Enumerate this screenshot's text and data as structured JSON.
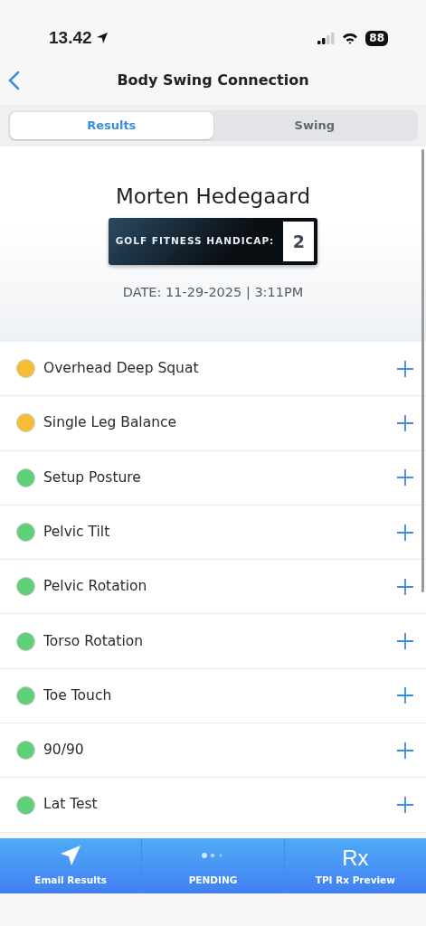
{
  "status_bar": {
    "time": "13.42",
    "battery": "88"
  },
  "nav": {
    "title": "Body Swing Connection"
  },
  "tabs": [
    {
      "label": "Results",
      "selected": true
    },
    {
      "label": "Swing",
      "selected": false
    }
  ],
  "profile": {
    "name": "Morten Hedegaard",
    "handicap_label": "GOLF FITNESS HANDICAP:",
    "handicap_value": "2",
    "date": "DATE: 11-29-2025 | 3:11PM"
  },
  "tests": [
    {
      "name": "Overhead Deep Squat",
      "color": "#f5bd36"
    },
    {
      "name": "Single Leg Balance",
      "color": "#f5bd36"
    },
    {
      "name": "Setup Posture",
      "color": "#5fcf78"
    },
    {
      "name": "Pelvic Tilt",
      "color": "#5fcf78"
    },
    {
      "name": "Pelvic Rotation",
      "color": "#5fcf78"
    },
    {
      "name": "Torso Rotation",
      "color": "#5fcf78"
    },
    {
      "name": "Toe Touch",
      "color": "#5fcf78"
    },
    {
      "name": "90/90",
      "color": "#5fcf78"
    },
    {
      "name": "Lat Test",
      "color": "#5fcf78"
    }
  ],
  "bottom_bar": [
    {
      "kind": "email",
      "label": "Email Results"
    },
    {
      "kind": "pending",
      "label": "PENDING"
    },
    {
      "kind": "rx",
      "label": "TPI Rx Preview",
      "icon_text": "Rx"
    }
  ]
}
